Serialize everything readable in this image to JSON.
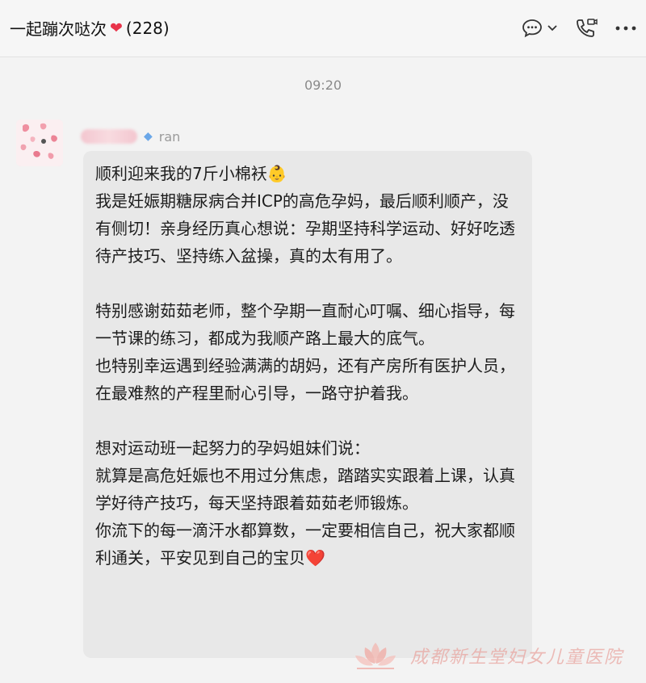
{
  "header": {
    "chat_title": "一起蹦次哒次",
    "member_count": "(228)",
    "title_icon": "heart-icon"
  },
  "timestamp": "09:20",
  "message": {
    "sender_name_visible": "ran",
    "lines": [
      "顺利迎来我的7斤小棉袄👶",
      "我是妊娠期糖尿病合并ICP的高危孕妈，最后顺利顺产，没有侧切！亲身经历真心想说：孕期坚持科学运动、好好吃透待产技巧、坚持练入盆操，真的太有用了。",
      "",
      "特别感谢茹茹老师，整个孕期一直耐心叮嘱、细心指导，每一节课的练习，都成为我顺产路上最大的底气。",
      "也特别幸运遇到经验满满的胡妈，还有产房所有医护人员，在最难熬的产程里耐心引导，一路守护着我。",
      "",
      "想对运动班一起努力的孕妈姐妹们说：",
      "就算是高危妊娠也不用过分焦虑，踏踏实实跟着上课，认真学好待产技巧，每天坚持跟着茹茹老师锻炼。",
      "你流下的每一滴汗水都算数，一定要相信自己，祝大家都顺利通关，平安见到自己的宝贝❤️"
    ]
  },
  "watermark": {
    "text": "成都新生堂妇女儿童医院"
  },
  "colors": {
    "bubble": "#e8e8e8",
    "heart": "#e8334a",
    "watermark": "#e9a6a1"
  }
}
